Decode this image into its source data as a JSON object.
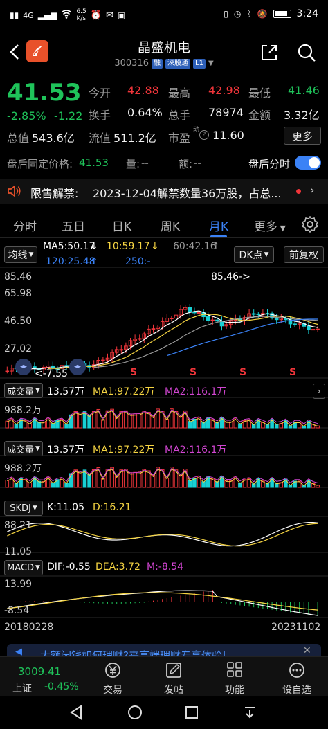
{
  "status": {
    "time": "3:24",
    "network": "4G",
    "speed": "6.5",
    "speed_unit": "K/s",
    "battery": "▮▮▮"
  },
  "header": {
    "stock_name": "晶盛机电",
    "code": "300316",
    "badge_margin": "融",
    "badge_connect": "深股通",
    "badge_level": "L1"
  },
  "quote": {
    "price": "41.53",
    "change_pct": "-2.85%",
    "change": "-1.22",
    "open_label": "今开",
    "open": "42.88",
    "high_label": "最高",
    "high": "42.98",
    "low_label": "最低",
    "low": "41.46",
    "turnover_label": "换手",
    "turnover": "0.64%",
    "volume_label": "总手",
    "volume": "78974",
    "amount_label": "金额",
    "amount": "3.32亿",
    "mktcap_label": "总值",
    "mktcap": "543.6亿",
    "float_label": "流值",
    "float_cap": "511.2亿",
    "pe_label": "市盈",
    "pe_sup": "动",
    "pe": "11.60",
    "more": "更多"
  },
  "after_hours": {
    "price_label": "盘后固定价格:",
    "price": "41.53",
    "qty_label": "量:",
    "qty": "--",
    "amt_label": "额:",
    "amt": "--",
    "timeshare_label": "盘后分时"
  },
  "notice": {
    "title": "限售解禁:",
    "text": "2023-12-04解禁数量36万股，占总..."
  },
  "tabs": [
    "分时",
    "五日",
    "日K",
    "周K",
    "月K",
    "更多"
  ],
  "chart_controls": {
    "ma_button": "均线",
    "dk_button": "DK点",
    "fq_button": "前复权"
  },
  "ma_legend": {
    "ma5": "MA5:50.17",
    "ma10": "10:59.17",
    "ma20": "60:42.16",
    "ma120": "120:25.48",
    "ma250": "250:-"
  },
  "kline_axis": {
    "y1": "85.46",
    "y2": "65.98",
    "y3": "46.50",
    "y4": "27.02",
    "y5": "7.55"
  },
  "kline_annotations": {
    "high_marker": "85.46->",
    "low_marker": "<-7.55",
    "sell_mark": "S"
  },
  "vol_panel_1": {
    "name": "成交量",
    "value": "13.57万",
    "ma1": "MA1:97.22万",
    "ma2": "MA2:116.1万",
    "axis_top": "988.2万"
  },
  "vol_panel_2": {
    "name": "成交量",
    "value": "13.57万",
    "ma1": "MA1:97.22万",
    "ma2": "MA2:116.1万",
    "axis_top": "988.2万"
  },
  "skdj": {
    "name": "SKDJ",
    "k": "K:11.05",
    "d": "D:16.21",
    "axis_top": "88.21",
    "axis_bottom": "11.05"
  },
  "macd": {
    "name": "MACD",
    "dif": "DIF:-0.55",
    "dea": "DEA:3.72",
    "m": "M:-8.54",
    "axis_top": "13.99",
    "axis_bottom": "-8.54"
  },
  "date_range": {
    "start": "20180228",
    "end": "20231102"
  },
  "banner": {
    "text": "大额闲钱如何理财?来高端理财专享体验!"
  },
  "bottom_bar": {
    "index_value": "3009.41",
    "index_name": "上证",
    "index_change": "-0.45%",
    "trade": "交易",
    "post": "发帖",
    "function": "功能",
    "watchlist": "设自选"
  },
  "colors": {
    "up": "#f0353a",
    "down": "#1fc35a",
    "cyan_bar": "#18d0d4",
    "accent_blue": "#3b82f6",
    "ma_white": "#ffffff",
    "ma_yellow": "#f5d442",
    "ma_purple": "#d045d0"
  }
}
